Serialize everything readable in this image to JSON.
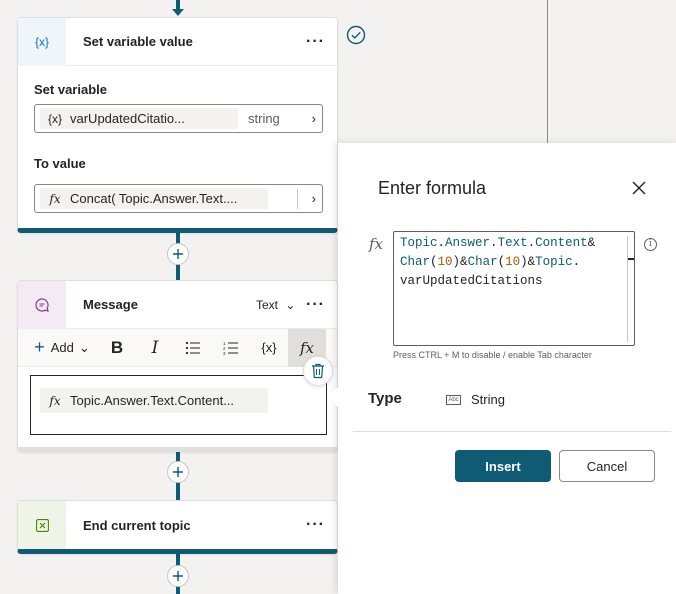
{
  "nodes": {
    "set_variable": {
      "icon_text": "{x}",
      "title": "Set variable value",
      "set_variable_label": "Set variable",
      "variable_icon": "{x}",
      "variable_name": "varUpdatedCitatio...",
      "variable_type": "string",
      "to_value_label": "To value",
      "value_icon": "fx",
      "value_text": "Concat( Topic.Answer.Text...."
    },
    "message": {
      "title": "Message",
      "format_label": "Text",
      "add_label": "Add",
      "toolbar": {
        "bold": "B",
        "italic": "I",
        "variable": "{x}",
        "formula": "fx"
      },
      "content_icon": "fx",
      "content_text": "Topic.Answer.Text.Content..."
    },
    "end_topic": {
      "title": "End current topic"
    }
  },
  "icons": {
    "set_variable_icon": "curly-braces-x-icon",
    "message_icon": "chat-bubble-icon",
    "end_icon": "close-box-icon",
    "check": "check-circle-icon",
    "trash": "trash-icon",
    "close": "close-icon",
    "info": "info-icon",
    "type_icon": "string-type-icon"
  },
  "panel": {
    "title": "Enter formula",
    "fx_label": "fx",
    "formula_lines": [
      "Topic.Answer.Text.Content&",
      "Char(10)&Char(10)&Topic.",
      "varUpdatedCitations"
    ],
    "hint": "Press CTRL + M to disable / enable Tab character",
    "type_label": "Type",
    "type_icon_text": "Abc",
    "type_value": "String",
    "insert_label": "Insert",
    "cancel_label": "Cancel"
  },
  "colors": {
    "accent": "#0f5b74",
    "background": "#f3f2f1",
    "set_variable_icon_bg": "#eef5fb",
    "message_icon_bg": "#f4eaf3",
    "end_icon_bg": "#eef5e6"
  }
}
